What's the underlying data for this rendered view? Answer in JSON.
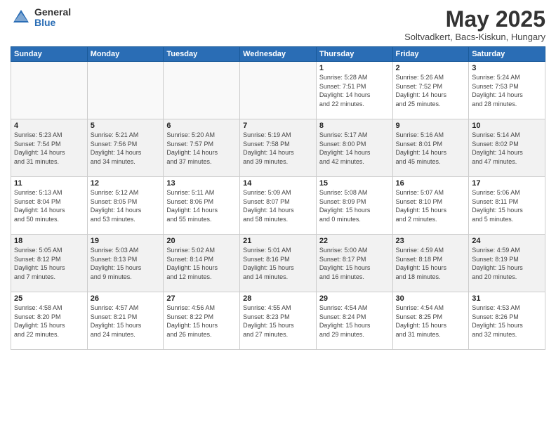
{
  "header": {
    "logo_general": "General",
    "logo_blue": "Blue",
    "month_title": "May 2025",
    "subtitle": "Soltvadkert, Bacs-Kiskun, Hungary"
  },
  "weekdays": [
    "Sunday",
    "Monday",
    "Tuesday",
    "Wednesday",
    "Thursday",
    "Friday",
    "Saturday"
  ],
  "weeks": [
    [
      {
        "day": "",
        "info": ""
      },
      {
        "day": "",
        "info": ""
      },
      {
        "day": "",
        "info": ""
      },
      {
        "day": "",
        "info": ""
      },
      {
        "day": "1",
        "info": "Sunrise: 5:28 AM\nSunset: 7:51 PM\nDaylight: 14 hours\nand 22 minutes."
      },
      {
        "day": "2",
        "info": "Sunrise: 5:26 AM\nSunset: 7:52 PM\nDaylight: 14 hours\nand 25 minutes."
      },
      {
        "day": "3",
        "info": "Sunrise: 5:24 AM\nSunset: 7:53 PM\nDaylight: 14 hours\nand 28 minutes."
      }
    ],
    [
      {
        "day": "4",
        "info": "Sunrise: 5:23 AM\nSunset: 7:54 PM\nDaylight: 14 hours\nand 31 minutes."
      },
      {
        "day": "5",
        "info": "Sunrise: 5:21 AM\nSunset: 7:56 PM\nDaylight: 14 hours\nand 34 minutes."
      },
      {
        "day": "6",
        "info": "Sunrise: 5:20 AM\nSunset: 7:57 PM\nDaylight: 14 hours\nand 37 minutes."
      },
      {
        "day": "7",
        "info": "Sunrise: 5:19 AM\nSunset: 7:58 PM\nDaylight: 14 hours\nand 39 minutes."
      },
      {
        "day": "8",
        "info": "Sunrise: 5:17 AM\nSunset: 8:00 PM\nDaylight: 14 hours\nand 42 minutes."
      },
      {
        "day": "9",
        "info": "Sunrise: 5:16 AM\nSunset: 8:01 PM\nDaylight: 14 hours\nand 45 minutes."
      },
      {
        "day": "10",
        "info": "Sunrise: 5:14 AM\nSunset: 8:02 PM\nDaylight: 14 hours\nand 47 minutes."
      }
    ],
    [
      {
        "day": "11",
        "info": "Sunrise: 5:13 AM\nSunset: 8:04 PM\nDaylight: 14 hours\nand 50 minutes."
      },
      {
        "day": "12",
        "info": "Sunrise: 5:12 AM\nSunset: 8:05 PM\nDaylight: 14 hours\nand 53 minutes."
      },
      {
        "day": "13",
        "info": "Sunrise: 5:11 AM\nSunset: 8:06 PM\nDaylight: 14 hours\nand 55 minutes."
      },
      {
        "day": "14",
        "info": "Sunrise: 5:09 AM\nSunset: 8:07 PM\nDaylight: 14 hours\nand 58 minutes."
      },
      {
        "day": "15",
        "info": "Sunrise: 5:08 AM\nSunset: 8:09 PM\nDaylight: 15 hours\nand 0 minutes."
      },
      {
        "day": "16",
        "info": "Sunrise: 5:07 AM\nSunset: 8:10 PM\nDaylight: 15 hours\nand 2 minutes."
      },
      {
        "day": "17",
        "info": "Sunrise: 5:06 AM\nSunset: 8:11 PM\nDaylight: 15 hours\nand 5 minutes."
      }
    ],
    [
      {
        "day": "18",
        "info": "Sunrise: 5:05 AM\nSunset: 8:12 PM\nDaylight: 15 hours\nand 7 minutes."
      },
      {
        "day": "19",
        "info": "Sunrise: 5:03 AM\nSunset: 8:13 PM\nDaylight: 15 hours\nand 9 minutes."
      },
      {
        "day": "20",
        "info": "Sunrise: 5:02 AM\nSunset: 8:14 PM\nDaylight: 15 hours\nand 12 minutes."
      },
      {
        "day": "21",
        "info": "Sunrise: 5:01 AM\nSunset: 8:16 PM\nDaylight: 15 hours\nand 14 minutes."
      },
      {
        "day": "22",
        "info": "Sunrise: 5:00 AM\nSunset: 8:17 PM\nDaylight: 15 hours\nand 16 minutes."
      },
      {
        "day": "23",
        "info": "Sunrise: 4:59 AM\nSunset: 8:18 PM\nDaylight: 15 hours\nand 18 minutes."
      },
      {
        "day": "24",
        "info": "Sunrise: 4:59 AM\nSunset: 8:19 PM\nDaylight: 15 hours\nand 20 minutes."
      }
    ],
    [
      {
        "day": "25",
        "info": "Sunrise: 4:58 AM\nSunset: 8:20 PM\nDaylight: 15 hours\nand 22 minutes."
      },
      {
        "day": "26",
        "info": "Sunrise: 4:57 AM\nSunset: 8:21 PM\nDaylight: 15 hours\nand 24 minutes."
      },
      {
        "day": "27",
        "info": "Sunrise: 4:56 AM\nSunset: 8:22 PM\nDaylight: 15 hours\nand 26 minutes."
      },
      {
        "day": "28",
        "info": "Sunrise: 4:55 AM\nSunset: 8:23 PM\nDaylight: 15 hours\nand 27 minutes."
      },
      {
        "day": "29",
        "info": "Sunrise: 4:54 AM\nSunset: 8:24 PM\nDaylight: 15 hours\nand 29 minutes."
      },
      {
        "day": "30",
        "info": "Sunrise: 4:54 AM\nSunset: 8:25 PM\nDaylight: 15 hours\nand 31 minutes."
      },
      {
        "day": "31",
        "info": "Sunrise: 4:53 AM\nSunset: 8:26 PM\nDaylight: 15 hours\nand 32 minutes."
      }
    ]
  ]
}
